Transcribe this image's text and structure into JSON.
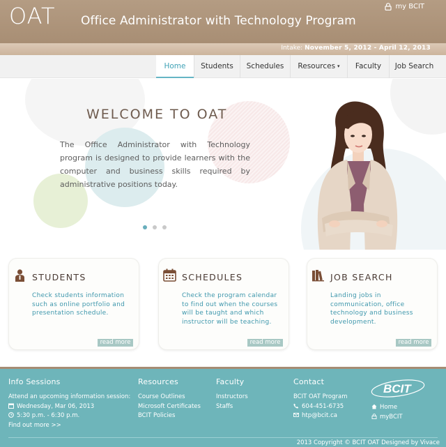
{
  "header": {
    "logo": "OAT",
    "title": "Office Administrator with Technology Program",
    "mybcit": "my BCIT",
    "intake_label": "Intake:",
    "intake_dates": "November 5, 2012 - April 12, 2013"
  },
  "nav": {
    "items": [
      {
        "label": "Home",
        "active": true
      },
      {
        "label": "Students"
      },
      {
        "label": "Schedules"
      },
      {
        "label": "Resources"
      },
      {
        "label": "Faculty"
      },
      {
        "label": "Job Search"
      }
    ],
    "resources_caret": "▾"
  },
  "hero": {
    "heading": "WELCOME TO OAT",
    "text": "The Office Administrator with Technology program is designed to provide learners with the computer and business skills required by administrative positions today.",
    "slides_total": 3,
    "active_slide": 1
  },
  "cards": [
    {
      "title": "STUDENTS",
      "icon": "student-icon",
      "desc": "Check students information such as online portfolio and presentation schedule.",
      "more": "read more"
    },
    {
      "title": "SCHEDULES",
      "icon": "calendar-icon",
      "desc": "Check the program calendar to find out when the courses will be taught and which instructor will be teaching.",
      "more": "read more"
    },
    {
      "title": "JOB SEARCH",
      "icon": "books-icon",
      "desc": "Landing jobs in communication, office technology and business development.",
      "more": "read more"
    }
  ],
  "footer": {
    "info": {
      "heading": "Info Sessions",
      "line1": "Attend an upcoming information session:",
      "date": "Wednesday, Mar 06, 2013",
      "time": "5:30 p.m. - 6:30 p.m.",
      "more": "Find out more >>"
    },
    "resources": {
      "heading": "Resources",
      "links": [
        "Course Outlines",
        "Microsoft Certificates",
        "BCIT Policies"
      ]
    },
    "faculty": {
      "heading": "Faculty",
      "links": [
        "Instructors",
        "Staffs"
      ]
    },
    "contact": {
      "heading": "Contact",
      "name": "BCIT OAT Program",
      "phone": "604-451-6735",
      "email": "htp@bcit.ca"
    },
    "brand": {
      "logo": "BCIT",
      "home": "Home",
      "mybcit": "myBCIT"
    },
    "copyright": "2013 Copyright © BCIT OAT Designed by Vivace"
  },
  "colors": {
    "header_brown": "#a88e74",
    "accent_teal": "#3fa2b6",
    "footer_teal": "#6eb5ba",
    "read_more": "#a8c8c4"
  }
}
